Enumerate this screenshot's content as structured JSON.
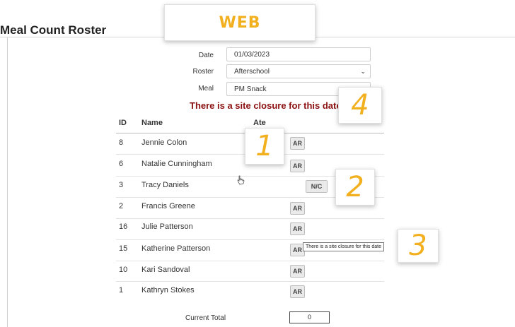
{
  "page": {
    "title": "Meal Count Roster"
  },
  "callouts": {
    "web": "WEB",
    "n1": "1",
    "n2": "2",
    "n3": "3",
    "n4": "4",
    "color": "#f2b01e"
  },
  "form": {
    "date_label": "Date",
    "date_value": "01/03/2023",
    "roster_label": "Roster",
    "roster_value": "Afterschool",
    "meal_label": "Meal",
    "meal_value": "PM Snack"
  },
  "closure_message": "There is a site closure for this date",
  "closure_color": "#8b0f0f",
  "table": {
    "headers": {
      "id": "ID",
      "name": "Name",
      "ate": "Ate"
    },
    "rows": [
      {
        "id": "8",
        "name": "Jennie Colon",
        "ate": "AR"
      },
      {
        "id": "6",
        "name": "Natalie Cunningham",
        "ate": "AR"
      },
      {
        "id": "3",
        "name": "Tracy Daniels",
        "ate": "N/C"
      },
      {
        "id": "2",
        "name": "Francis Greene",
        "ate": "AR"
      },
      {
        "id": "16",
        "name": "Julie Patterson",
        "ate": "AR"
      },
      {
        "id": "15",
        "name": "Katherine Patterson",
        "ate": "AR"
      },
      {
        "id": "10",
        "name": "Kari Sandoval",
        "ate": "AR"
      },
      {
        "id": "1",
        "name": "Kathryn Stokes",
        "ate": "AR"
      }
    ]
  },
  "tooltip": "There is a site closure for this date",
  "total": {
    "label": "Current Total",
    "value": "0"
  }
}
